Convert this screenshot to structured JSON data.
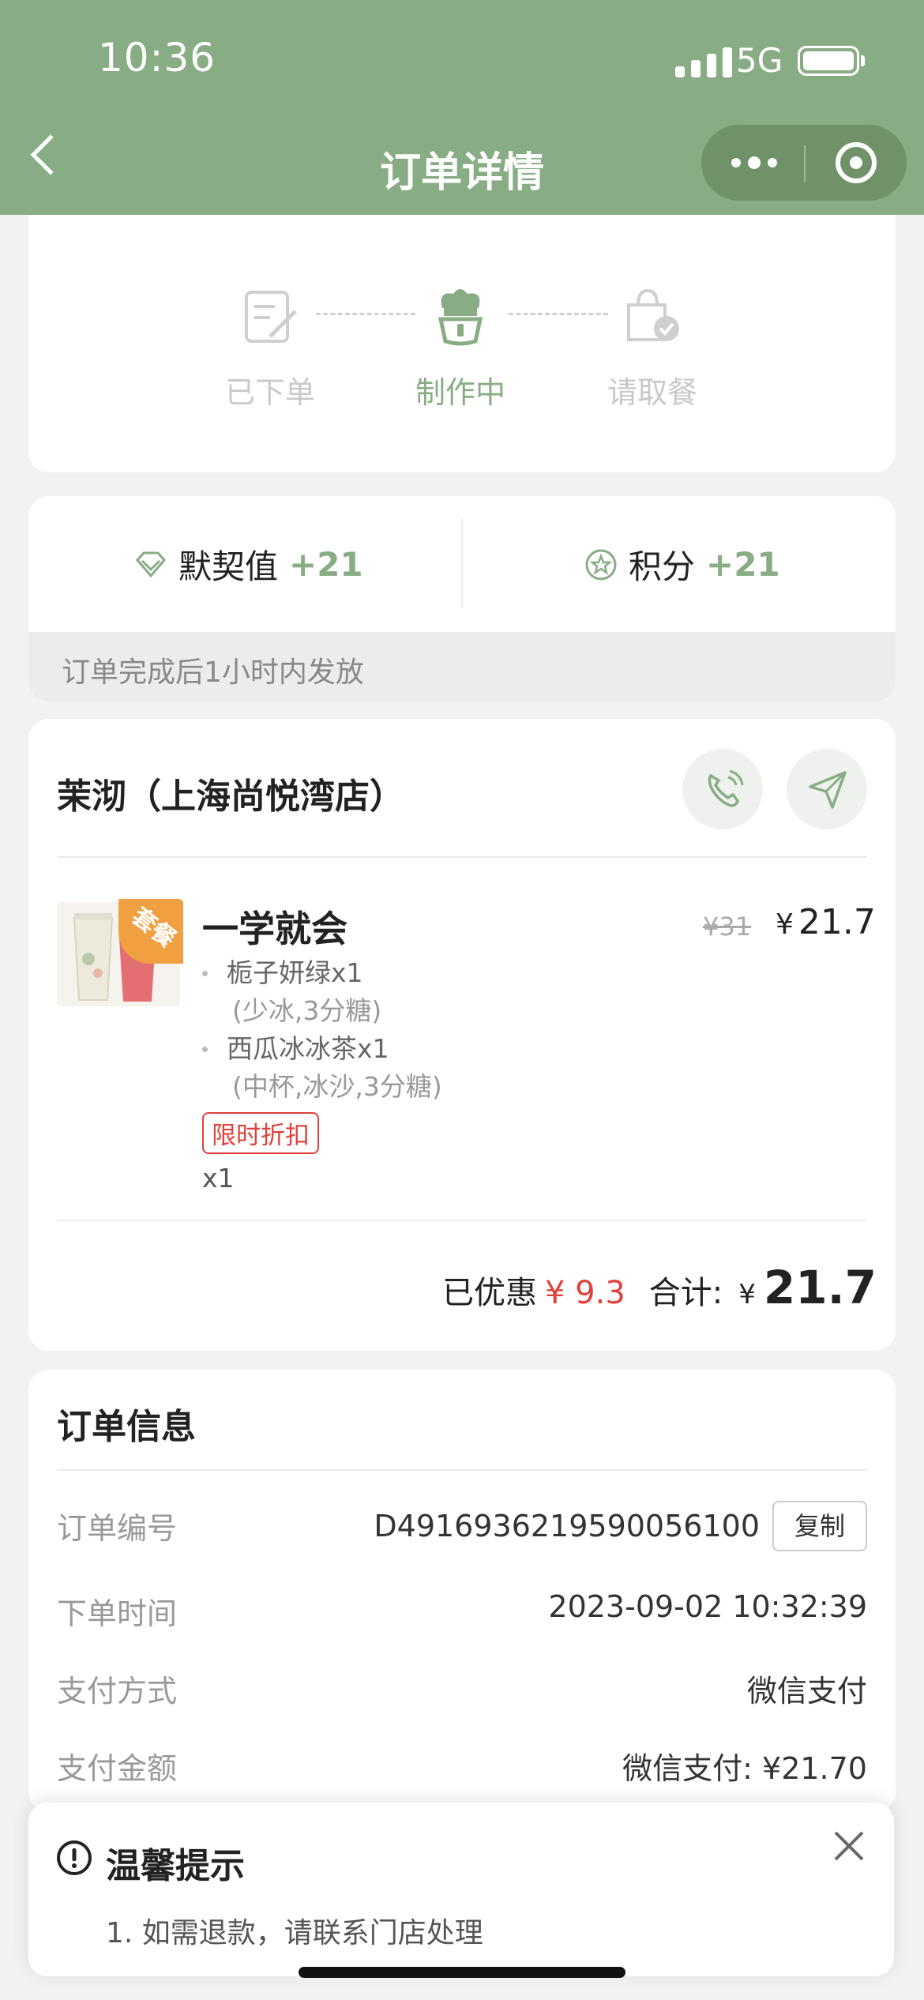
{
  "status_bar": {
    "time": "10:36",
    "network": "5G"
  },
  "nav": {
    "title": "订单详情"
  },
  "progress": {
    "steps": [
      {
        "label": "已下单",
        "state": "done"
      },
      {
        "label": "制作中",
        "state": "active"
      },
      {
        "label": "请取餐",
        "state": "pending"
      }
    ]
  },
  "rewards": {
    "items": [
      {
        "label": "默契值",
        "value": "+21",
        "icon": "diamond-icon"
      },
      {
        "label": "积分",
        "value": "+21",
        "icon": "star-icon"
      }
    ],
    "note": "订单完成后1小时内发放"
  },
  "store": {
    "name": "茉沏（上海尚悦湾店）",
    "item": {
      "badge": "套餐",
      "name": "一学就会",
      "original_price": "¥31",
      "price_symbol": "¥",
      "price": "21.7",
      "components": [
        {
          "name": "栀子妍绿x1",
          "options": "(少冰,3分糖)"
        },
        {
          "name": "西瓜冰冰茶x1",
          "options": "(中杯,冰沙,3分糖)"
        }
      ],
      "tag": "限时折扣",
      "qty": "x1"
    },
    "summary": {
      "discount_label": "已优惠",
      "discount_value": "¥ 9.3",
      "total_label": "合计:",
      "total_symbol": "¥",
      "total_value": "21.7"
    }
  },
  "order_info": {
    "title": "订单信息",
    "rows": [
      {
        "label": "订单编号",
        "value": "D4916936219590056100"
      },
      {
        "label": "下单时间",
        "value": "2023-09-02 10:32:39"
      },
      {
        "label": "支付方式",
        "value": "微信支付"
      },
      {
        "label": "支付金额",
        "value": "微信支付: ¥21.70"
      }
    ],
    "copy_label": "复制"
  },
  "tip": {
    "title": "温馨提示",
    "text": "1. 如需退款，请联系门店处理"
  },
  "colors": {
    "brand": "#88ad84",
    "discount": "#e0413a"
  }
}
